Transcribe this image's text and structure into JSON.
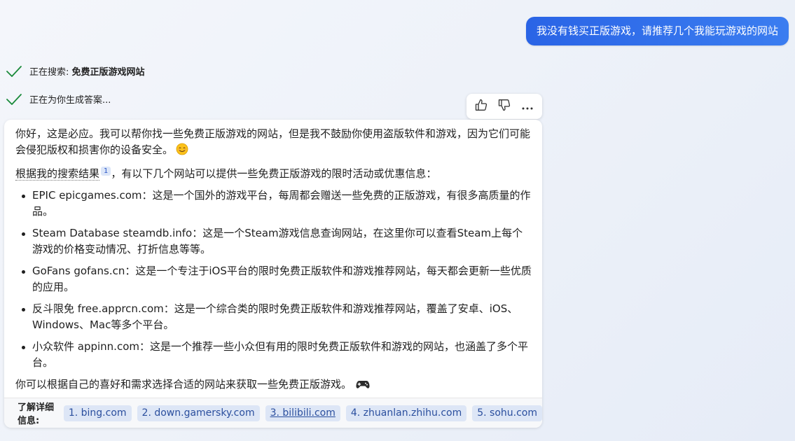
{
  "user_message": "我没有钱买正版游戏，请推荐几个我能玩游戏的网站",
  "status": {
    "searching_prefix": "正在搜索: ",
    "searching_query": "免费正版游戏网站",
    "generating": "正在为你生成答案..."
  },
  "icons": {
    "check": "check-icon",
    "like": "thumbs-up-icon",
    "dislike": "thumbs-down-icon",
    "more": "more-icon",
    "smile": "smile-emoji",
    "game": "game-controller-emoji"
  },
  "colors": {
    "accent": "#2e6fea",
    "check": "#1a8a3a",
    "chip_bg": "#dde6f6",
    "chip_text": "#2b4f9e"
  },
  "answer": {
    "intro": "你好，这是必应。我可以帮你找一些免费正版游戏的网站，但是我不鼓励你使用盗版软件和游戏，因为它们可能会侵犯版权和损害你的设备安全。",
    "search_prefix": "根据我的搜索结果",
    "citation": "1",
    "search_suffix": "，有以下几个网站可以提供一些免费正版游戏的限时活动或优惠信息：",
    "sites": [
      "EPIC epicgames.com：这是一个国外的游戏平台，每周都会赠送一些免费的正版游戏，有很多高质量的作品。",
      "Steam Database steamdb.info：这是一个Steam游戏信息查询网站，在这里你可以查看Steam上每个游戏的价格变动情况、打折信息等等。",
      "GoFans gofans.cn：这是一个专注于iOS平台的限时免费正版软件和游戏推荐网站，每天都会更新一些优质的应用。",
      "反斗限免 free.apprcn.com：这是一个综合类的限时免费正版软件和游戏推荐网站，覆盖了安卓、iOS、Windows、Mac等多个平台。",
      "小众软件 appinn.com：这是一个推荐一些小众但有用的限时免费正版软件和游戏的网站，也涵盖了多个平台。"
    ],
    "closing": "你可以根据自己的喜好和需求选择合适的网站来获取一些免费正版游戏。"
  },
  "learn_more": {
    "label": "了解详细信息:",
    "links": [
      "1. bing.com",
      "2. down.gamersky.com",
      "3. bilibili.com",
      "4. zhuanlan.zhihu.com",
      "5. sohu.com"
    ]
  }
}
